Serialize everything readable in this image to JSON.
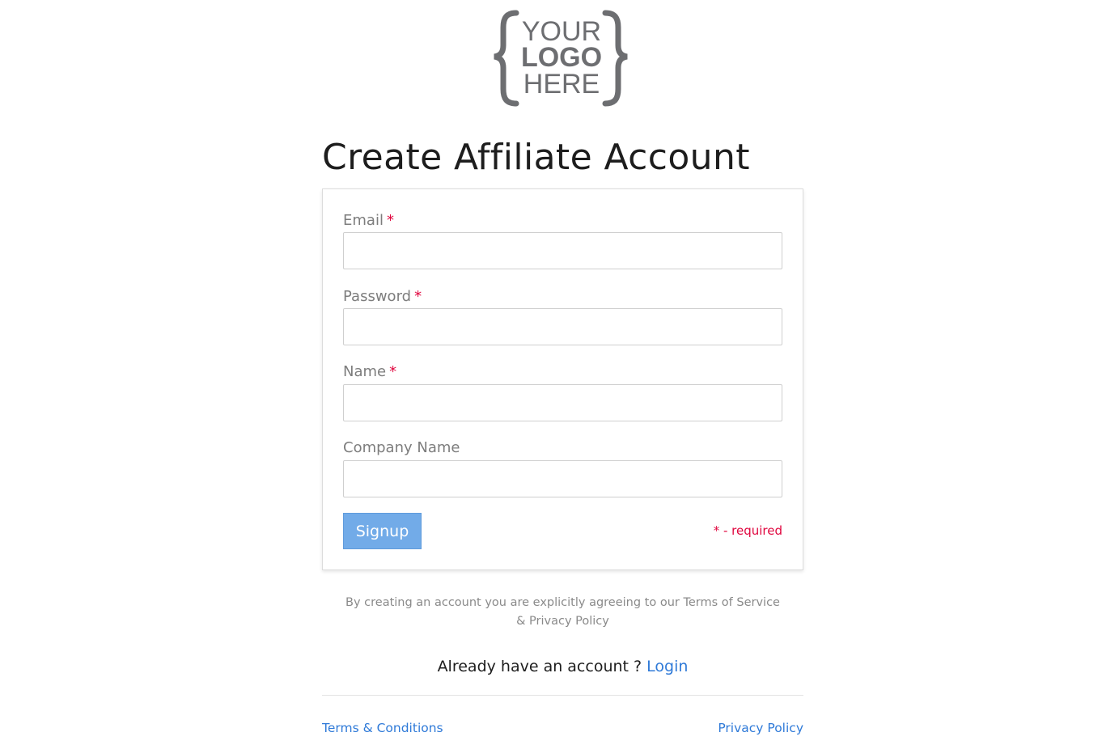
{
  "logo": {
    "line1": "YOUR",
    "line2": "LOGO",
    "line3": "HERE",
    "color": "#6d6e71"
  },
  "page_title": "Create Affiliate Account",
  "form": {
    "email": {
      "label": "Email",
      "required_mark": "*",
      "value": "",
      "placeholder": ""
    },
    "password": {
      "label": "Password",
      "required_mark": "*",
      "value": "",
      "placeholder": ""
    },
    "name": {
      "label": "Name",
      "required_mark": "*",
      "value": "",
      "placeholder": ""
    },
    "company": {
      "label": "Company Name",
      "value": "",
      "placeholder": ""
    },
    "signup_label": "Signup",
    "required_note": "* - required"
  },
  "agreement_text": "By creating an account you are explicitly agreeing to our Terms of Service & Privacy Policy",
  "already": {
    "text": "Already have an account ?",
    "login_label": "Login"
  },
  "footer": {
    "terms_label": "Terms & Conditions",
    "privacy_label": "Privacy Policy"
  },
  "colors": {
    "accent": "#2f7ad8",
    "button": "#72abe8",
    "required": "#e0063e"
  }
}
